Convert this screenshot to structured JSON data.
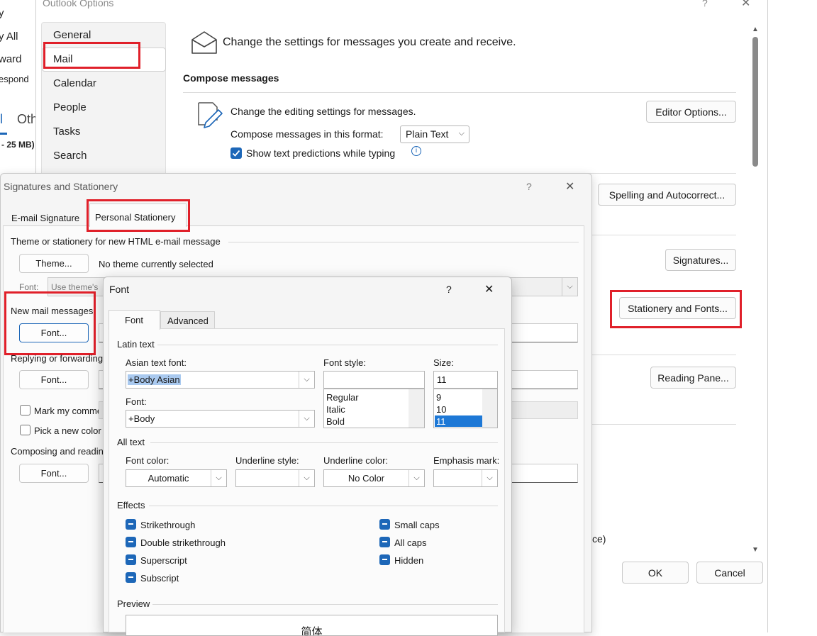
{
  "background_window": {
    "labels": [
      "y",
      "y All",
      "ward",
      "espond",
      "Oth",
      "- 25 MB)"
    ]
  },
  "options_window": {
    "title": "Outlook Options",
    "help": "?",
    "close": "✕",
    "nav": [
      "General",
      "Mail",
      "Calendar",
      "People",
      "Tasks",
      "Search"
    ],
    "header": "Change the settings for messages you create and receive.",
    "compose_heading": "Compose messages",
    "editing_text": "Change the editing settings for messages.",
    "editor_options_button": "Editor Options...",
    "format_label": "Compose messages in this format:",
    "format_value": "Plain Text",
    "predictions_label": "Show text predictions while typing",
    "spelling_button": "Spelling and Autocorrect...",
    "signatures_button": "Signatures...",
    "stationery_button": "Stationery and Fonts...",
    "reading_pane_button": "Reading Pane...",
    "partial_text": "ce)",
    "ok_button": "OK",
    "cancel_button": "Cancel"
  },
  "signatures_dialog": {
    "title": "Signatures and Stationery",
    "help": "?",
    "close": "✕",
    "tabs": [
      "E-mail Signature",
      "Personal Stationery"
    ],
    "theme_section": "Theme or stationery for new HTML e-mail message",
    "theme_button": "Theme...",
    "theme_status": "No theme currently selected",
    "font_label": "Font:",
    "font_value": "Use theme's",
    "new_mail_label": "New mail messages",
    "font_button": "Font...",
    "reply_label": "Replying or forwarding",
    "mark_comments": "Mark my comme",
    "pick_color": "Pick a new color",
    "composing_label": "Composing and readin"
  },
  "font_dialog": {
    "title": "Font",
    "help": "?",
    "close": "✕",
    "tabs": [
      "Font",
      "Advanced"
    ],
    "latin_section": "Latin text",
    "asian_font_label": "Asian text font:",
    "asian_font_value": "+Body Asian",
    "font_style_label": "Font style:",
    "size_label": "Size:",
    "size_value": "11",
    "font_label": "Font:",
    "font_value": "+Body",
    "styles": [
      "Regular",
      "Italic",
      "Bold"
    ],
    "sizes": [
      "9",
      "10",
      "11"
    ],
    "all_text_section": "All text",
    "font_color_label": "Font color:",
    "font_color_value": "Automatic",
    "underline_style_label": "Underline style:",
    "underline_color_label": "Underline color:",
    "underline_color_value": "No Color",
    "emphasis_label": "Emphasis mark:",
    "effects_section": "Effects",
    "effects_left": [
      "Strikethrough",
      "Double strikethrough",
      "Superscript",
      "Subscript"
    ],
    "effects_right": [
      "Small caps",
      "All caps",
      "Hidden"
    ],
    "preview_section": "Preview",
    "preview_text": "简体"
  },
  "colors": {
    "highlight_red": "#e0202a",
    "accent_blue": "#1d67b8"
  }
}
